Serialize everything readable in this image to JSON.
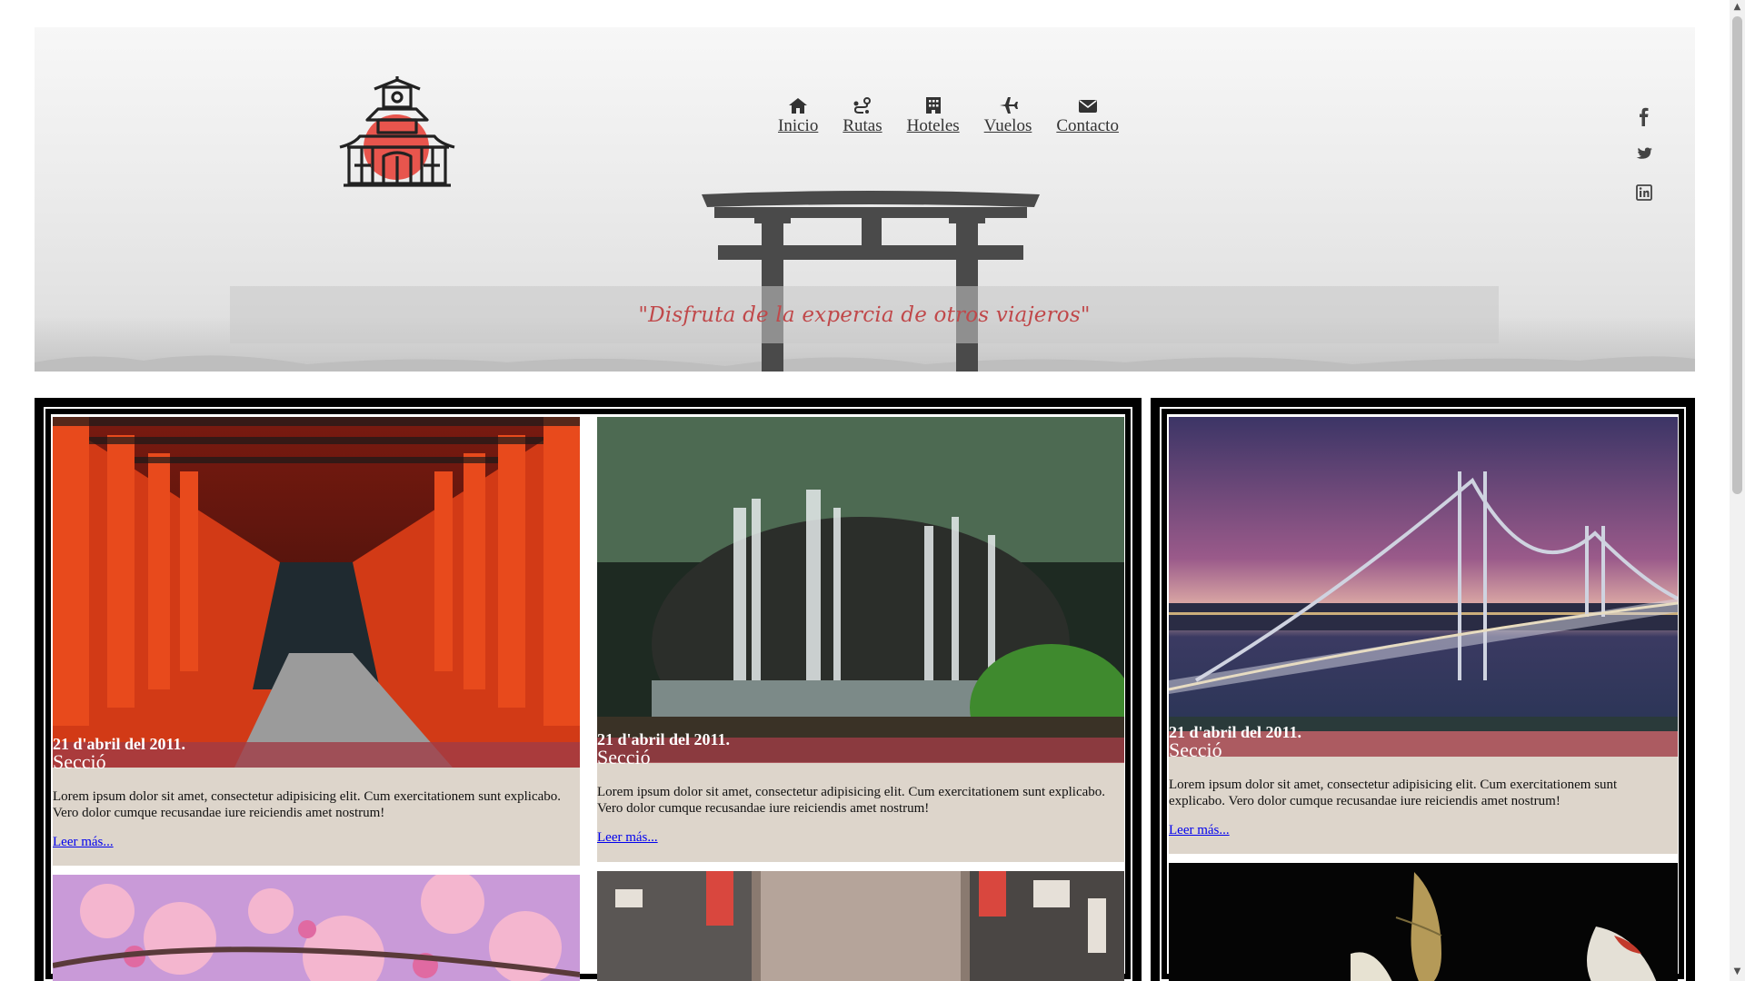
{
  "nav": {
    "items": [
      {
        "label": "Inicio",
        "icon": "home-icon"
      },
      {
        "label": "Rutas",
        "icon": "route-icon"
      },
      {
        "label": "Hoteles",
        "icon": "hotel-icon"
      },
      {
        "label": "Vuelos",
        "icon": "plane-icon"
      },
      {
        "label": "Contacto",
        "icon": "envelope-icon"
      }
    ]
  },
  "social": [
    "facebook-icon",
    "twitter-icon",
    "linkedin-icon"
  ],
  "hero": {
    "quote": "\"Disfruta de la expercia de otros viajeros\""
  },
  "cards": [
    {
      "image": "torii-gates-corridor",
      "date": "21 d'abril del 2011.",
      "section": "Secció",
      "text": "Lorem ipsum dolor sit amet, consectetur adipisicing elit. Cum exercitationem sunt explicabo. Vero dolor cumque recusandae iure reiciendis amet nostrum!",
      "link": "Leer más..."
    },
    {
      "image": "forest-waterfall",
      "date": "21 d'abril del 2011.",
      "section": "Secció",
      "text": "Lorem ipsum dolor sit amet, consectetur adipisicing elit. Cum exercitationem sunt explicabo. Vero dolor cumque recusandae iure reiciendis amet nostrum!",
      "link": "Leer más..."
    },
    {
      "image": "suspension-bridge-sunset",
      "date": "21 d'abril del 2011.",
      "section": "Secció",
      "text": "Lorem ipsum dolor sit amet, consectetur adipisicing elit. Cum exercitationem sunt explicabo. Vero dolor cumque recusandae iure reiciendis amet nostrum!",
      "link": "Leer más..."
    }
  ],
  "thumbs": [
    "cherry-blossom",
    "city-street",
    "koi-fish"
  ],
  "colors": {
    "quote": "#c0484a",
    "card_bg": "#ddd5cb",
    "section_band": "#a03c46",
    "link": "#0000ee",
    "logo_sun": "#e8554d"
  }
}
